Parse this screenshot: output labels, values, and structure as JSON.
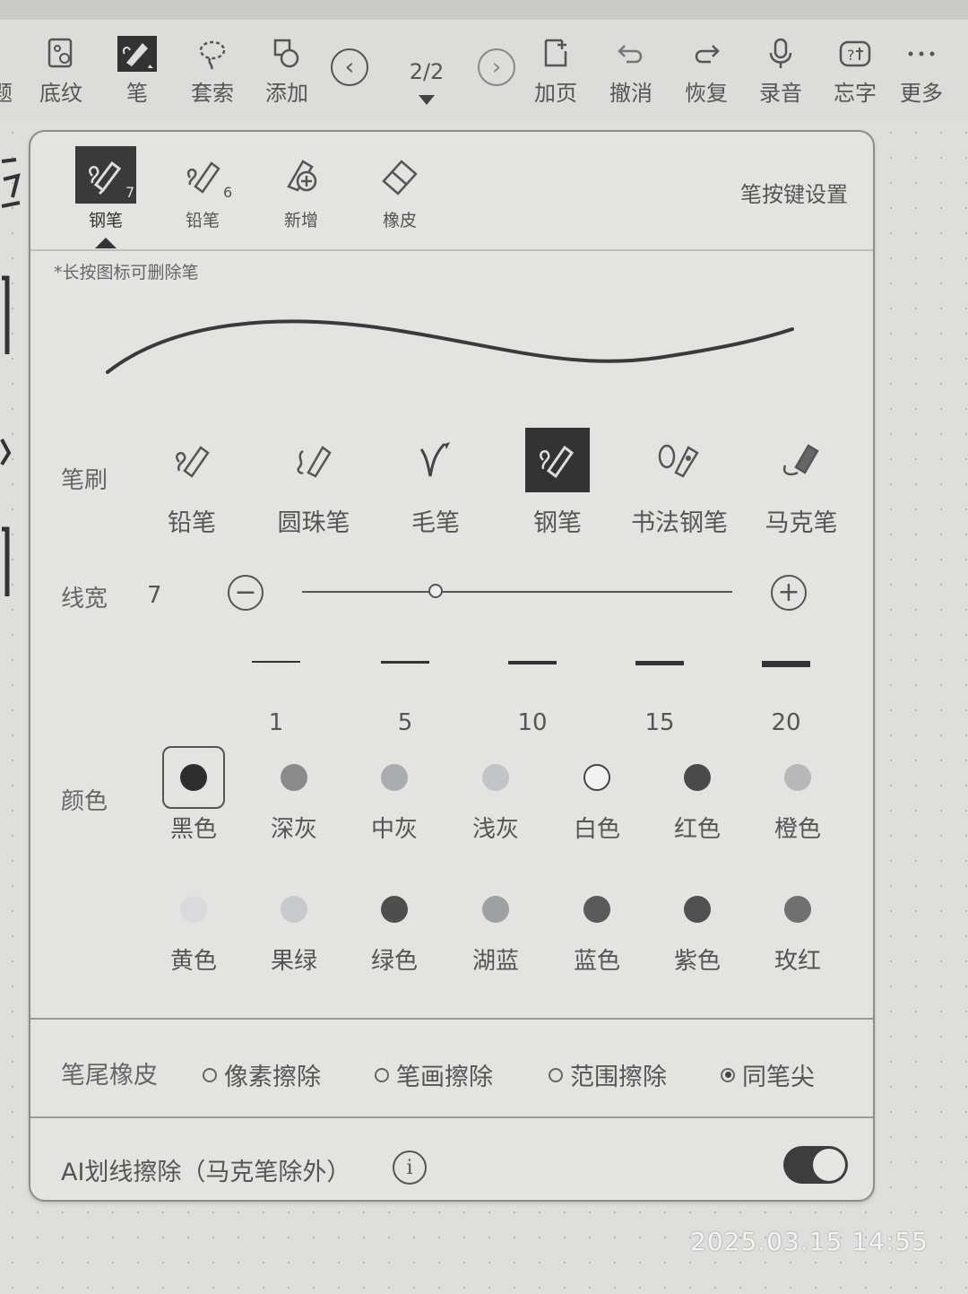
{
  "toolbar": {
    "items": [
      {
        "label": "底纹",
        "icon": "pattern-icon"
      },
      {
        "label": "笔",
        "icon": "pen-icon"
      },
      {
        "label": "套索",
        "icon": "lasso-icon"
      },
      {
        "label": "添加",
        "icon": "add-shape-icon"
      },
      {
        "label": "加页",
        "icon": "add-page-icon"
      },
      {
        "label": "撤消",
        "icon": "undo-icon"
      },
      {
        "label": "恢复",
        "icon": "redo-icon"
      },
      {
        "label": "录音",
        "icon": "mic-icon"
      },
      {
        "label": "忘字",
        "icon": "forgot-char-icon"
      },
      {
        "label": "更多",
        "icon": "more-icon"
      }
    ],
    "left_partial_label": "题",
    "page_indicator": "2/2"
  },
  "pen_panel": {
    "tabs": [
      {
        "label": "钢笔",
        "badge": "7",
        "active": true
      },
      {
        "label": "铅笔",
        "badge": "6",
        "active": false
      },
      {
        "label": "新增",
        "badge": "",
        "active": false
      },
      {
        "label": "橡皮",
        "badge": "",
        "active": false
      }
    ],
    "pen_key_settings": "笔按键设置",
    "hint": "*长按图标可删除笔",
    "brush": {
      "label": "笔刷",
      "options": [
        {
          "label": "铅笔",
          "selected": false
        },
        {
          "label": "圆珠笔",
          "selected": false
        },
        {
          "label": "毛笔",
          "selected": false
        },
        {
          "label": "钢笔",
          "selected": true
        },
        {
          "label": "书法钢笔",
          "selected": false
        },
        {
          "label": "马克笔",
          "selected": false
        }
      ]
    },
    "line_width": {
      "label": "线宽",
      "value": "7",
      "slider_fraction": 0.31,
      "presets": [
        "1",
        "5",
        "10",
        "15",
        "20"
      ]
    },
    "color": {
      "label": "颜色",
      "swatches": [
        {
          "label": "黑色",
          "hex": "#2e2e2e",
          "selected": true
        },
        {
          "label": "深灰",
          "hex": "#8a8a8a",
          "selected": false
        },
        {
          "label": "中灰",
          "hex": "#a9adaf",
          "selected": false
        },
        {
          "label": "浅灰",
          "hex": "#c3c4c6",
          "selected": false
        },
        {
          "label": "白色",
          "hex": "#f2f2f2",
          "selected": false
        },
        {
          "label": "红色",
          "hex": "#4a4a4a",
          "selected": false
        },
        {
          "label": "橙色",
          "hex": "#b8b8b8",
          "selected": false
        },
        {
          "label": "黄色",
          "hex": "#dadadc",
          "selected": false
        },
        {
          "label": "果绿",
          "hex": "#c8c9cc",
          "selected": false
        },
        {
          "label": "绿色",
          "hex": "#4e4e4e",
          "selected": false
        },
        {
          "label": "湖蓝",
          "hex": "#9ea0a2",
          "selected": false
        },
        {
          "label": "蓝色",
          "hex": "#5a5a5a",
          "selected": false
        },
        {
          "label": "紫色",
          "hex": "#505050",
          "selected": false
        },
        {
          "label": "玫红",
          "hex": "#707070",
          "selected": false
        }
      ]
    },
    "tail_eraser": {
      "label": "笔尾橡皮",
      "options": [
        {
          "label": "像素擦除",
          "selected": false
        },
        {
          "label": "笔画擦除",
          "selected": false
        },
        {
          "label": "范围擦除",
          "selected": false
        },
        {
          "label": "同笔尖",
          "selected": true
        }
      ]
    },
    "ai_erase": {
      "label": "AI划线擦除（马克笔除外）",
      "enabled": true
    }
  },
  "photo_timestamp": "2025.03.15   14:55"
}
